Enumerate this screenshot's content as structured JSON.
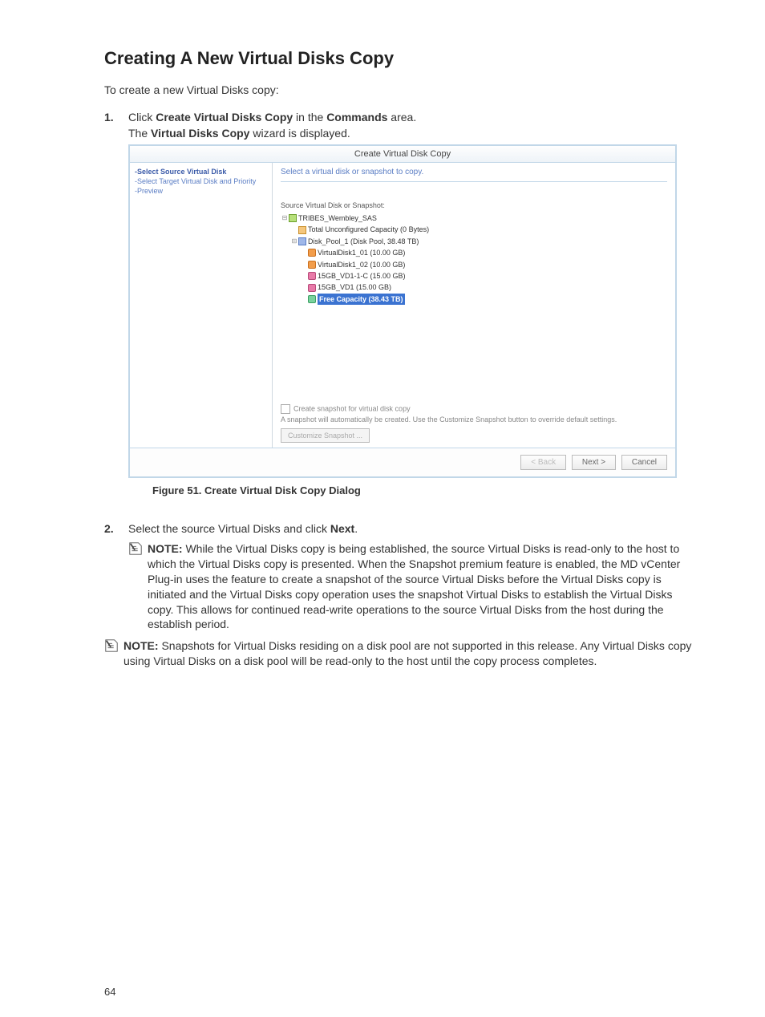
{
  "heading": "Creating A New Virtual Disks Copy",
  "intro": "To create a new Virtual Disks copy:",
  "step1": {
    "pre": "Click ",
    "bold1": "Create Virtual Disks Copy",
    "mid": " in the ",
    "bold2": "Commands",
    "post": " area.",
    "line2_pre": "The ",
    "line2_bold": "Virtual Disks Copy",
    "line2_post": " wizard is displayed."
  },
  "dialog": {
    "title": "Create Virtual Disk Copy",
    "side": {
      "s1": "-Select Source Virtual Disk",
      "s2": "-Select Target Virtual Disk and Priority",
      "s3": "-Preview"
    },
    "prompt": "Select a virtual disk or snapshot to copy.",
    "subhead": "Source Virtual Disk or Snapshot:",
    "tree": {
      "root": "TRIBES_Wembley_SAS",
      "unconf": "Total Unconfigured Capacity (0 Bytes)",
      "pool": "Disk_Pool_1 (Disk Pool, 38.48 TB)",
      "vd1": "VirtualDisk1_01 (10.00 GB)",
      "vd2": "VirtualDisk1_02 (10.00 GB)",
      "vdc": "15GB_VD1-1-C (15.00 GB)",
      "vd3": "15GB_VD1 (15.00 GB)",
      "free": "Free Capacity (38.43 TB)"
    },
    "snap_chk": "Create snapshot for virtual disk copy",
    "snap_note": "A snapshot will automatically be created. Use the Customize Snapshot button to override default settings.",
    "snap_btn": "Customize Snapshot ...",
    "back": "< Back",
    "next": "Next >",
    "cancel": "Cancel"
  },
  "figure_caption": "Figure 51. Create Virtual Disk Copy Dialog",
  "step2": {
    "pre": "Select the source Virtual Disks and click ",
    "bold": "Next",
    "post": "."
  },
  "note1": {
    "label": "NOTE: ",
    "text": "While the Virtual Disks copy is being established, the source Virtual Disks is read-only to the host to which the Virtual Disks copy is presented. When the Snapshot premium feature is enabled, the MD vCenter Plug-in uses the feature to create a snapshot of the source Virtual Disks before the Virtual Disks copy is initiated and the Virtual Disks copy operation uses the snapshot Virtual Disks to establish the Virtual Disks copy. This allows for continued read-write operations to the source Virtual Disks from the host during the establish period."
  },
  "note2": {
    "label": "NOTE: ",
    "text": "Snapshots for Virtual Disks residing on a disk pool are not supported in this release. Any Virtual Disks copy using Virtual Disks on a disk pool will be read-only to the host until the copy process completes."
  },
  "page_number": "64"
}
